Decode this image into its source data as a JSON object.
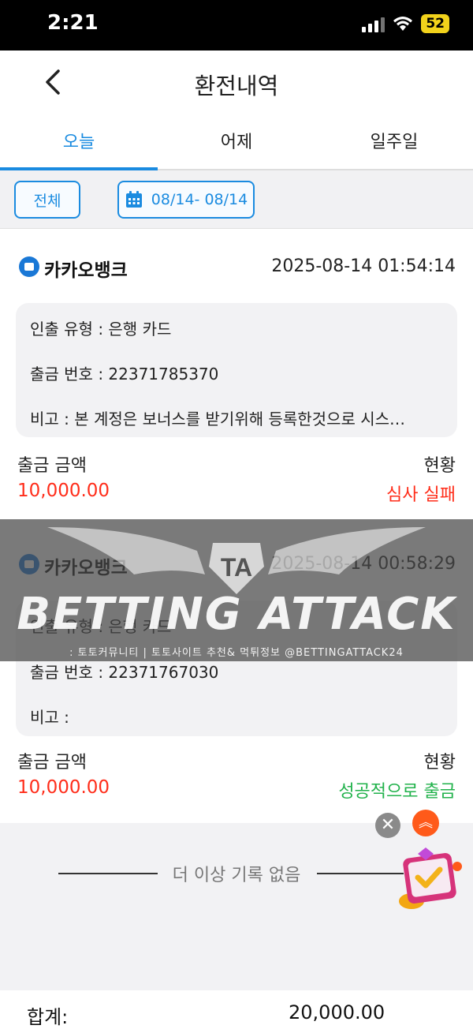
{
  "status_bar": {
    "time": "2:21",
    "battery": "52"
  },
  "header": {
    "title": "환전내역"
  },
  "tabs": [
    {
      "label": "오늘",
      "active": true
    },
    {
      "label": "어제",
      "active": false
    },
    {
      "label": "일주일",
      "active": false
    }
  ],
  "filters": {
    "all_label": "전체",
    "date_range": "08/14- 08/14"
  },
  "records": [
    {
      "bank": "카카오뱅크",
      "datetime": "2025-08-14 01:54:14",
      "type_line": "인출 유형 :  은행 카드",
      "number_line": "출금 번호 :  22371785370",
      "note_line": "비고 :  본 계정은 보너스를 받기위해 등록한것으로 시스…",
      "amount_label": "출금 금액",
      "amount": "10,000.00",
      "status_label": "현황",
      "status": "심사 실패"
    },
    {
      "bank": "카카오뱅크",
      "datetime": "2025-08-14 00:58:29",
      "type_line": "인출 유형 :  은행 카드",
      "number_line": "출금 번호 :  22371767030",
      "note_line": "비고 :",
      "amount_label": "출금 금액",
      "amount": "10,000.00",
      "status_label": "현황",
      "status": "성공적으로 출금"
    }
  ],
  "no_more": "더 이상 기록 없음",
  "footer": {
    "total_label": "합계:",
    "total_value": "20,000.00"
  },
  "watermark": {
    "title": "BETTING ATTACK",
    "emblem": "TA",
    "subtitle": ": 토토커뮤니티 | 토토사이트 추천& 먹튀정보 @BETTINGATTACK24"
  },
  "colors": {
    "accent": "#1a8be0",
    "fail": "#ff2d1a",
    "success": "#21b24b"
  },
  "icons": {
    "back": "chevron-left-icon",
    "calendar": "calendar-icon",
    "close": "close-icon",
    "scroll_top": "double-chevron-up-icon"
  }
}
